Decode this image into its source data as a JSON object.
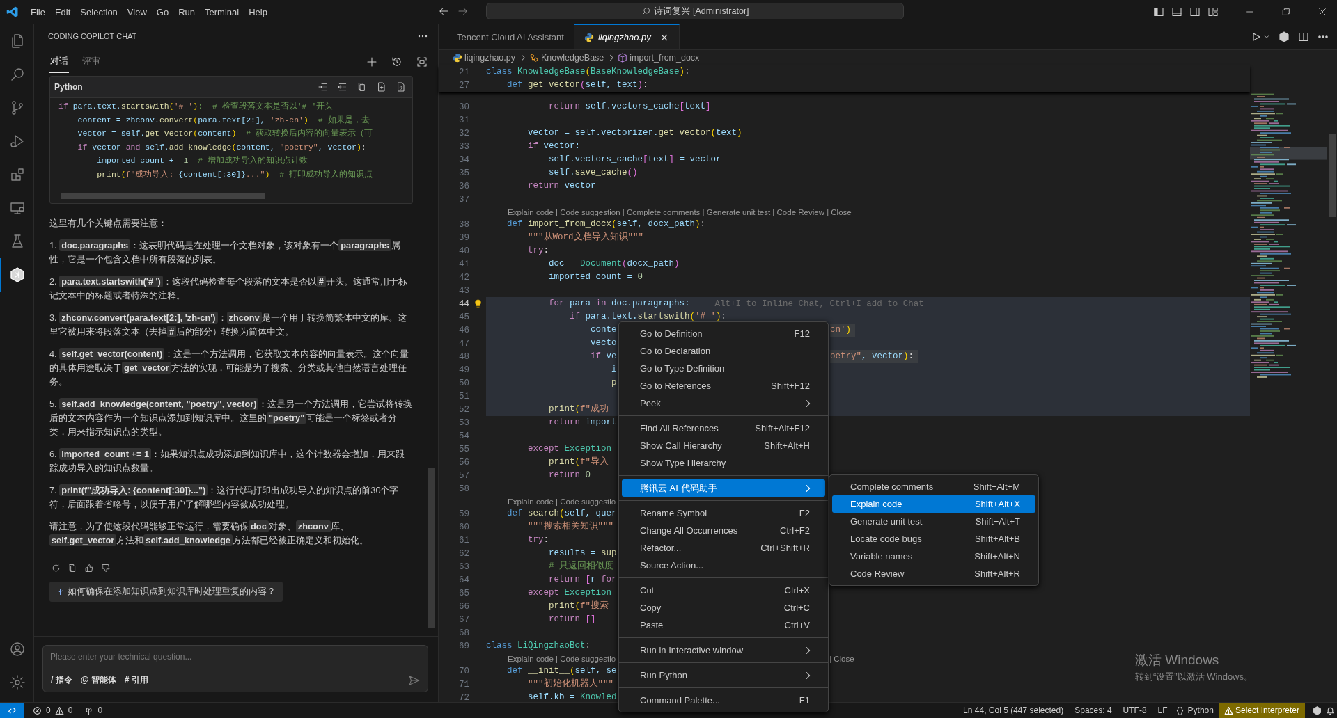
{
  "titlebar": {
    "menu": [
      "File",
      "Edit",
      "Selection",
      "View",
      "Go",
      "Run",
      "Terminal",
      "Help"
    ],
    "search": "诗词复兴 [Administrator]"
  },
  "activity_bar": [
    {
      "selected": false
    },
    {
      "selected": false
    },
    {
      "selected": false
    },
    {
      "selected": false
    },
    {
      "selected": false
    },
    {
      "selected": false
    },
    {
      "selected": false
    },
    {
      "selected": true
    },
    {
      "selected": false
    },
    {
      "selected": false
    }
  ],
  "chat": {
    "title": "CODING COPILOT CHAT",
    "tabs": [
      {
        "label": "对话",
        "selected": true
      },
      {
        "label": "评审",
        "selected": false
      }
    ],
    "code_block": {
      "language": "Python",
      "lines": [
        [
          {
            "text": "if ",
            "kind": "ctl"
          },
          {
            "text": "para.text.",
            "kind": "var"
          },
          {
            "text": "startswith",
            "kind": "fn"
          },
          {
            "text": "(",
            "kind": "br"
          },
          {
            "text": "'# '",
            "kind": "str"
          },
          {
            "text": ")",
            "kind": "br"
          },
          {
            "text": ":  # 检查段落文本是否以'# '开头",
            "kind": "cmt"
          }
        ],
        [
          {
            "text": "    content = zhconv.",
            "kind": "var"
          },
          {
            "text": "convert",
            "kind": "fn"
          },
          {
            "text": "(",
            "kind": "br"
          },
          {
            "text": "para.text[2:], ",
            "kind": "var"
          },
          {
            "text": "'zh-cn'",
            "kind": "str"
          },
          {
            "text": ")",
            "kind": "br"
          },
          {
            "text": "  # 如果是，去",
            "kind": "cmt"
          }
        ],
        [
          {
            "text": "    vector = self.",
            "kind": "var"
          },
          {
            "text": "get_vector",
            "kind": "fn"
          },
          {
            "text": "(",
            "kind": "br"
          },
          {
            "text": "content",
            "kind": "var"
          },
          {
            "text": ")",
            "kind": "br"
          },
          {
            "text": "  # 获取转换后内容的向量表示（可",
            "kind": "cmt"
          }
        ],
        [
          {
            "text": "    if ",
            "kind": "ctl"
          },
          {
            "text": "vector ",
            "kind": "var"
          },
          {
            "text": "and ",
            "kind": "ctl"
          },
          {
            "text": "self.",
            "kind": "var"
          },
          {
            "text": "add_knowledge",
            "kind": "fn"
          },
          {
            "text": "(",
            "kind": "br"
          },
          {
            "text": "content, ",
            "kind": "var"
          },
          {
            "text": "\"poetry\"",
            "kind": "str"
          },
          {
            "text": ", vector",
            "kind": "var"
          },
          {
            "text": ")",
            "kind": "br"
          },
          {
            "text": ":",
            "kind": "p"
          }
        ],
        [
          {
            "text": "        imported_count += ",
            "kind": "var"
          },
          {
            "text": "1",
            "kind": "num"
          },
          {
            "text": "  # 增加成功导入的知识点计数",
            "kind": "cmt"
          }
        ],
        [
          {
            "text": "        print",
            "kind": "fn"
          },
          {
            "text": "(",
            "kind": "br"
          },
          {
            "text": "f\"成功导入: ",
            "kind": "str"
          },
          {
            "text": "{content[:30]}",
            "kind": "var"
          },
          {
            "text": "...\"",
            "kind": "str"
          },
          {
            "text": ")",
            "kind": "br"
          },
          {
            "text": "  # 打印成功导入的知识点",
            "kind": "cmt"
          }
        ]
      ]
    },
    "paragraphs": [
      [
        {
          "text": "这里有几个关键点需要注意：",
          "kind": "text"
        }
      ],
      [
        {
          "text": "1. ",
          "kind": "text"
        },
        {
          "text": "doc.paragraphs",
          "kind": "code"
        },
        {
          "text": "：这表明代码是在处理一个文档对象，该对象有一个",
          "kind": "text"
        },
        {
          "text": "paragraphs",
          "kind": "code"
        },
        {
          "text": "属性，它是一个包含文档中所有段落的列表。",
          "kind": "text"
        }
      ],
      [
        {
          "text": "2. ",
          "kind": "text"
        },
        {
          "text": "para.text.startswith('# ')",
          "kind": "code"
        },
        {
          "text": "：这段代码检查每个段落的文本是否以",
          "kind": "text"
        },
        {
          "text": "#",
          "kind": "code"
        },
        {
          "text": "开头。这通常用于标记文本中的标题或者特殊的注释。",
          "kind": "text"
        }
      ],
      [
        {
          "text": "3. ",
          "kind": "text"
        },
        {
          "text": "zhconv.convert(para.text[2:], 'zh-cn')",
          "kind": "code"
        },
        {
          "text": "：",
          "kind": "text"
        },
        {
          "text": "zhconv",
          "kind": "code"
        },
        {
          "text": "是一个用于转换简繁体中文的库。这里它被用来将段落文本（去掉",
          "kind": "text"
        },
        {
          "text": "#",
          "kind": "code"
        },
        {
          "text": "后的部分）转换为简体中文。",
          "kind": "text"
        }
      ],
      [
        {
          "text": "4. ",
          "kind": "text"
        },
        {
          "text": "self.get_vector(content)",
          "kind": "code"
        },
        {
          "text": "：这是一个方法调用，它获取文本内容的向量表示。这个向量的具体用途取决于",
          "kind": "text"
        },
        {
          "text": "get_vector",
          "kind": "code"
        },
        {
          "text": "方法的实现，可能是为了搜索、分类或其他自然语言处理任务。",
          "kind": "text"
        }
      ],
      [
        {
          "text": "5. ",
          "kind": "text"
        },
        {
          "text": "self.add_knowledge(content, \"poetry\", vector)",
          "kind": "code"
        },
        {
          "text": "：这是另一个方法调用，它尝试将转换后的文本内容作为一个知识点添加到知识库中。这里的",
          "kind": "text"
        },
        {
          "text": "\"poetry\"",
          "kind": "code"
        },
        {
          "text": "可能是一个标签或者分类，用来指示知识点的类型。",
          "kind": "text"
        }
      ],
      [
        {
          "text": "6. ",
          "kind": "text"
        },
        {
          "text": "imported_count += 1",
          "kind": "code"
        },
        {
          "text": "：如果知识点成功添加到知识库中，这个计数器会增加，用来跟踪成功导入的知识点数量。",
          "kind": "text"
        }
      ],
      [
        {
          "text": "7. ",
          "kind": "text"
        },
        {
          "text": "print(f\"成功导入: {content[:30]}...\")",
          "kind": "code"
        },
        {
          "text": "：这行代码打印出成功导入的知识点的前30个字符，后面跟着省略号，以便于用户了解哪些内容被成功处理。",
          "kind": "text"
        }
      ],
      [
        {
          "text": "请注意，为了使这段代码能够正常运行，需要确保",
          "kind": "text"
        },
        {
          "text": "doc",
          "kind": "code"
        },
        {
          "text": "对象、",
          "kind": "text"
        },
        {
          "text": "zhconv",
          "kind": "code"
        },
        {
          "text": "库、",
          "kind": "text"
        },
        {
          "text": "self.get_vector",
          "kind": "code"
        },
        {
          "text": "方法和",
          "kind": "text"
        },
        {
          "text": "self.add_knowledge",
          "kind": "code"
        },
        {
          "text": "方法都已经被正确定义和初始化。",
          "kind": "text"
        }
      ]
    ],
    "suggestion": "如何确保在添加知识点到知识库时处理重复的内容？",
    "input": {
      "placeholder": "Please enter your technical question...",
      "chips": [
        "/ 指令",
        "@ 智能体",
        "# 引用"
      ]
    }
  },
  "editor": {
    "tabs": [
      {
        "label": "Tencent Cloud AI Assistant",
        "selected": false
      },
      {
        "label": "liqingzhao.py",
        "selected": true
      }
    ],
    "breadcrumb": [
      "liqingzhao.py",
      "KnowledgeBase",
      "import_from_docx"
    ],
    "sticky": [
      {
        "n": "21",
        "code": [
          {
            "text": "class ",
            "kind": "kw"
          },
          {
            "text": "KnowledgeBase",
            "kind": "cls"
          },
          {
            "text": "(",
            "kind": "br"
          },
          {
            "text": "BaseKnowledgeBase",
            "kind": "cls"
          },
          {
            "text": ")",
            "kind": "br"
          },
          {
            "text": ":",
            "kind": "p"
          }
        ]
      },
      {
        "n": "27",
        "code": [
          {
            "text": "    def ",
            "kind": "kw"
          },
          {
            "text": "get_vector",
            "kind": "fn"
          },
          {
            "text": "(",
            "kind": "br2"
          },
          {
            "text": "self, text",
            "kind": "var"
          },
          {
            "text": ")",
            "kind": "br2"
          },
          {
            "text": ":",
            "kind": "p"
          }
        ]
      }
    ],
    "hint": "Alt+I to Inline Chat, Ctrl+I add to Chat",
    "lines": [
      {
        "kind": "code",
        "n": "30",
        "selected": false,
        "current": false,
        "code": [
          {
            "text": "            return ",
            "kind": "ctl"
          },
          {
            "text": "self.vectors_cache",
            "kind": "var"
          },
          {
            "text": "[",
            "kind": "br2"
          },
          {
            "text": "text",
            "kind": "var"
          },
          {
            "text": "]",
            "kind": "br2"
          }
        ]
      },
      {
        "kind": "code",
        "n": "31",
        "selected": false,
        "current": false
      },
      {
        "kind": "code",
        "n": "32",
        "selected": false,
        "current": false,
        "code": [
          {
            "text": "        vector = self.vectorizer.",
            "kind": "var"
          },
          {
            "text": "get_vector",
            "kind": "fn"
          },
          {
            "text": "(",
            "kind": "br"
          },
          {
            "text": "text",
            "kind": "var"
          },
          {
            "text": ")",
            "kind": "br"
          }
        ]
      },
      {
        "kind": "code",
        "n": "33",
        "selected": false,
        "current": false,
        "code": [
          {
            "text": "        if ",
            "kind": "ctl"
          },
          {
            "text": "vector:",
            "kind": "var"
          }
        ]
      },
      {
        "kind": "code",
        "n": "34",
        "selected": false,
        "current": false,
        "code": [
          {
            "text": "            self.vectors_cache",
            "kind": "var"
          },
          {
            "text": "[",
            "kind": "br2"
          },
          {
            "text": "text",
            "kind": "var"
          },
          {
            "text": "]",
            "kind": "br2"
          },
          {
            "text": " = vector",
            "kind": "var"
          }
        ]
      },
      {
        "kind": "code",
        "n": "35",
        "selected": false,
        "current": false,
        "code": [
          {
            "text": "            self.",
            "kind": "var"
          },
          {
            "text": "save_cache",
            "kind": "fn"
          },
          {
            "text": "()",
            "kind": "br2"
          }
        ]
      },
      {
        "kind": "code",
        "n": "36",
        "selected": false,
        "current": false,
        "code": [
          {
            "text": "        return ",
            "kind": "ctl"
          },
          {
            "text": "vector",
            "kind": "var"
          }
        ]
      },
      {
        "kind": "code",
        "n": "37",
        "selected": false,
        "current": false
      },
      {
        "kind": "lens",
        "text": "Explain code | Code suggestion | Complete comments | Generate unit test | Code Review | Close"
      },
      {
        "kind": "code",
        "n": "38",
        "selected": false,
        "current": false,
        "code": [
          {
            "text": "    def ",
            "kind": "kw"
          },
          {
            "text": "import_from_docx",
            "kind": "fn"
          },
          {
            "text": "(",
            "kind": "br"
          },
          {
            "text": "self, docx_path",
            "kind": "var"
          },
          {
            "text": ")",
            "kind": "br"
          },
          {
            "text": ":",
            "kind": "p"
          }
        ]
      },
      {
        "kind": "code",
        "n": "39",
        "selected": false,
        "current": false,
        "code": [
          {
            "text": "        \"\"\"从Word文档导入知识\"\"\"",
            "kind": "str"
          }
        ]
      },
      {
        "kind": "code",
        "n": "40",
        "selected": false,
        "current": false,
        "code": [
          {
            "text": "        try",
            "kind": "ctl"
          },
          {
            "text": ":",
            "kind": "p"
          }
        ]
      },
      {
        "kind": "code",
        "n": "41",
        "selected": false,
        "current": false,
        "code": [
          {
            "text": "            doc = ",
            "kind": "var"
          },
          {
            "text": "Document",
            "kind": "cls"
          },
          {
            "text": "(",
            "kind": "br2"
          },
          {
            "text": "docx_path",
            "kind": "var"
          },
          {
            "text": ")",
            "kind": "br2"
          }
        ]
      },
      {
        "kind": "code",
        "n": "42",
        "selected": false,
        "current": false,
        "code": [
          {
            "text": "            imported_count = ",
            "kind": "var"
          },
          {
            "text": "0",
            "kind": "num"
          }
        ]
      },
      {
        "kind": "code",
        "n": "43",
        "selected": false,
        "current": false
      },
      {
        "kind": "code",
        "n": "44",
        "selected": true,
        "current": true,
        "code": [
          {
            "text": "            for ",
            "kind": "ctl"
          },
          {
            "text": "para ",
            "kind": "var"
          },
          {
            "text": "in ",
            "kind": "ctl"
          },
          {
            "text": "doc.paragraphs:",
            "kind": "var"
          }
        ]
      },
      {
        "kind": "code",
        "n": "45",
        "selected": true,
        "current": false,
        "code": [
          {
            "text": "                if ",
            "kind": "ctl"
          },
          {
            "text": "para.text.",
            "kind": "var"
          },
          {
            "text": "startswith",
            "kind": "fn"
          },
          {
            "text": "(",
            "kind": "br"
          },
          {
            "text": "'# '",
            "kind": "str"
          },
          {
            "text": ")",
            "kind": "br"
          },
          {
            "text": ":",
            "kind": "p"
          }
        ]
      },
      {
        "kind": "code",
        "n": "46",
        "selected": true,
        "current": false,
        "code": [
          {
            "text": "                    conte",
            "kind": "var"
          }
        ],
        "tail": [
          {
            "text": "cn'",
            "kind": "str"
          },
          {
            "text": ")",
            "kind": "br"
          }
        ]
      },
      {
        "kind": "code",
        "n": "47",
        "selected": true,
        "current": false,
        "code": [
          {
            "text": "                    vecto",
            "kind": "var"
          }
        ]
      },
      {
        "kind": "code",
        "n": "48",
        "selected": true,
        "current": false,
        "code": [
          {
            "text": "                    if ",
            "kind": "ctl"
          },
          {
            "text": "ve",
            "kind": "var"
          }
        ],
        "tail": [
          {
            "text": "oetry\"",
            "kind": "str"
          },
          {
            "text": ", vector",
            "kind": "var"
          },
          {
            "text": ")",
            "kind": "br"
          },
          {
            "text": ":",
            "kind": "p"
          }
        ]
      },
      {
        "kind": "code",
        "n": "49",
        "selected": true,
        "current": false,
        "code": [
          {
            "text": "                        i",
            "kind": "var"
          }
        ]
      },
      {
        "kind": "code",
        "n": "50",
        "selected": true,
        "current": false,
        "code": [
          {
            "text": "                        p",
            "kind": "fn"
          }
        ]
      },
      {
        "kind": "code",
        "n": "51",
        "selected": true,
        "current": false
      },
      {
        "kind": "code",
        "n": "52",
        "selected": true,
        "current": false,
        "code": [
          {
            "text": "            print",
            "kind": "fn"
          },
          {
            "text": "(",
            "kind": "br"
          },
          {
            "text": "f\"成功",
            "kind": "str"
          }
        ]
      },
      {
        "kind": "code",
        "n": "53",
        "selected": false,
        "current": false,
        "code": [
          {
            "text": "            return ",
            "kind": "ctl"
          },
          {
            "text": "import",
            "kind": "var"
          }
        ]
      },
      {
        "kind": "code",
        "n": "54",
        "selected": false,
        "current": false
      },
      {
        "kind": "code",
        "n": "55",
        "selected": false,
        "current": false,
        "code": [
          {
            "text": "        except ",
            "kind": "ctl"
          },
          {
            "text": "Exception",
            "kind": "cls"
          }
        ]
      },
      {
        "kind": "code",
        "n": "56",
        "selected": false,
        "current": false,
        "code": [
          {
            "text": "            print",
            "kind": "fn"
          },
          {
            "text": "(",
            "kind": "br"
          },
          {
            "text": "f\"导入",
            "kind": "str"
          }
        ]
      },
      {
        "kind": "code",
        "n": "57",
        "selected": false,
        "current": false,
        "code": [
          {
            "text": "            return ",
            "kind": "ctl"
          },
          {
            "text": "0",
            "kind": "num"
          }
        ]
      },
      {
        "kind": "code",
        "n": "58",
        "selected": false,
        "current": false
      },
      {
        "kind": "lens",
        "text": "Explain code | Code suggestio"
      },
      {
        "kind": "code",
        "n": "59",
        "selected": false,
        "current": false,
        "code": [
          {
            "text": "    def ",
            "kind": "kw"
          },
          {
            "text": "search",
            "kind": "fn"
          },
          {
            "text": "(",
            "kind": "br"
          },
          {
            "text": "self, quer",
            "kind": "var"
          }
        ]
      },
      {
        "kind": "code",
        "n": "60",
        "selected": false,
        "current": false,
        "code": [
          {
            "text": "        \"\"\"搜索相关知识\"\"\"",
            "kind": "str"
          }
        ]
      },
      {
        "kind": "code",
        "n": "61",
        "selected": false,
        "current": false,
        "code": [
          {
            "text": "        try",
            "kind": "ctl"
          },
          {
            "text": ":",
            "kind": "p"
          }
        ]
      },
      {
        "kind": "code",
        "n": "62",
        "selected": false,
        "current": false,
        "code": [
          {
            "text": "            results = ",
            "kind": "var"
          },
          {
            "text": "sup",
            "kind": "fn"
          }
        ]
      },
      {
        "kind": "code",
        "n": "63",
        "selected": false,
        "current": false,
        "code": [
          {
            "text": "            # 只返回相似度",
            "kind": "cmt"
          }
        ]
      },
      {
        "kind": "code",
        "n": "64",
        "selected": false,
        "current": false,
        "code": [
          {
            "text": "            return ",
            "kind": "ctl"
          },
          {
            "text": "[",
            "kind": "br2"
          },
          {
            "text": "r ",
            "kind": "var"
          },
          {
            "text": "for",
            "kind": "ctl"
          }
        ]
      },
      {
        "kind": "code",
        "n": "65",
        "selected": false,
        "current": false,
        "code": [
          {
            "text": "        except ",
            "kind": "ctl"
          },
          {
            "text": "Exception",
            "kind": "cls"
          }
        ]
      },
      {
        "kind": "code",
        "n": "66",
        "selected": false,
        "current": false,
        "code": [
          {
            "text": "            print",
            "kind": "fn"
          },
          {
            "text": "(",
            "kind": "br"
          },
          {
            "text": "f\"搜索",
            "kind": "str"
          }
        ]
      },
      {
        "kind": "code",
        "n": "67",
        "selected": false,
        "current": false,
        "code": [
          {
            "text": "            return ",
            "kind": "ctl"
          },
          {
            "text": "[]",
            "kind": "br2"
          }
        ]
      },
      {
        "kind": "code",
        "n": "68",
        "selected": false,
        "current": false
      },
      {
        "kind": "code",
        "n": "69",
        "selected": false,
        "current": false,
        "code": [
          {
            "text": "class ",
            "kind": "kw"
          },
          {
            "text": "LiQingzhaoBot",
            "kind": "cls"
          },
          {
            "text": ":",
            "kind": "p"
          }
        ]
      },
      {
        "kind": "lens",
        "text": "Explain code | Code suggestio",
        "tail": "| Close"
      },
      {
        "kind": "code",
        "n": "70",
        "selected": false,
        "current": false,
        "code": [
          {
            "text": "    def ",
            "kind": "kw"
          },
          {
            "text": "__init__",
            "kind": "fn"
          },
          {
            "text": "(",
            "kind": "br"
          },
          {
            "text": "self, se",
            "kind": "var"
          }
        ]
      },
      {
        "kind": "code",
        "n": "71",
        "selected": false,
        "current": false,
        "code": [
          {
            "text": "        \"\"\"初始化机器人\"\"\"",
            "kind": "str"
          }
        ]
      },
      {
        "kind": "code",
        "n": "72",
        "selected": false,
        "current": false,
        "code": [
          {
            "text": "        self.kb = ",
            "kind": "var"
          },
          {
            "text": "Knowled",
            "kind": "cls"
          }
        ]
      }
    ]
  },
  "context_menu": {
    "groups": [
      {
        "items": [
          {
            "label": "Go to Definition",
            "shortcut": "F12",
            "submenu": false,
            "selected": false
          },
          {
            "label": "Go to Declaration",
            "submenu": false,
            "selected": false
          },
          {
            "label": "Go to Type Definition",
            "submenu": false,
            "selected": false
          },
          {
            "label": "Go to References",
            "shortcut": "Shift+F12",
            "submenu": false,
            "selected": false
          },
          {
            "label": "Peek",
            "submenu": true,
            "selected": false
          }
        ]
      },
      {
        "items": [
          {
            "label": "Find All References",
            "shortcut": "Shift+Alt+F12",
            "submenu": false,
            "selected": false
          },
          {
            "label": "Show Call Hierarchy",
            "shortcut": "Shift+Alt+H",
            "submenu": false,
            "selected": false
          },
          {
            "label": "Show Type Hierarchy",
            "submenu": false,
            "selected": false
          }
        ]
      },
      {
        "items": [
          {
            "label": "腾讯云 AI 代码助手",
            "submenu": true,
            "selected": true
          }
        ]
      },
      {
        "items": [
          {
            "label": "Rename Symbol",
            "shortcut": "F2",
            "submenu": false,
            "selected": false
          },
          {
            "label": "Change All Occurrences",
            "shortcut": "Ctrl+F2",
            "submenu": false,
            "selected": false
          },
          {
            "label": "Refactor...",
            "shortcut": "Ctrl+Shift+R",
            "submenu": false,
            "selected": false
          },
          {
            "label": "Source Action...",
            "submenu": false,
            "selected": false
          }
        ]
      },
      {
        "items": [
          {
            "label": "Cut",
            "shortcut": "Ctrl+X",
            "submenu": false,
            "selected": false
          },
          {
            "label": "Copy",
            "shortcut": "Ctrl+C",
            "submenu": false,
            "selected": false
          },
          {
            "label": "Paste",
            "shortcut": "Ctrl+V",
            "submenu": false,
            "selected": false
          }
        ]
      },
      {
        "items": [
          {
            "label": "Run in Interactive window",
            "submenu": true,
            "selected": false
          }
        ]
      },
      {
        "items": [
          {
            "label": "Run Python",
            "submenu": true,
            "selected": false
          }
        ]
      },
      {
        "items": [
          {
            "label": "Command Palette...",
            "shortcut": "F1",
            "submenu": false,
            "selected": false
          }
        ]
      }
    ]
  },
  "submenu": {
    "items": [
      {
        "label": "Complete comments",
        "shortcut": "Shift+Alt+M",
        "selected": false
      },
      {
        "label": "Explain code",
        "shortcut": "Shift+Alt+X",
        "selected": true
      },
      {
        "label": "Generate unit test",
        "shortcut": "Shift+Alt+T",
        "selected": false
      },
      {
        "label": "Locate code bugs",
        "shortcut": "Shift+Alt+B",
        "selected": false
      },
      {
        "label": "Variable names",
        "shortcut": "Shift+Alt+N",
        "selected": false
      },
      {
        "label": "Code Review",
        "shortcut": "Shift+Alt+R",
        "selected": false
      }
    ]
  },
  "windows_notice": {
    "title": "激活 Windows",
    "subtitle": "转到“设置”以激活 Windows。"
  },
  "status_bar": {
    "errors": "0",
    "warnings": "0",
    "ports": "0",
    "items": [
      "Ln 44, Col 5 (447 selected)",
      "Spaces: 4",
      "UTF-8",
      "LF"
    ],
    "language": "Python",
    "interpreter": "Select Interpreter"
  }
}
